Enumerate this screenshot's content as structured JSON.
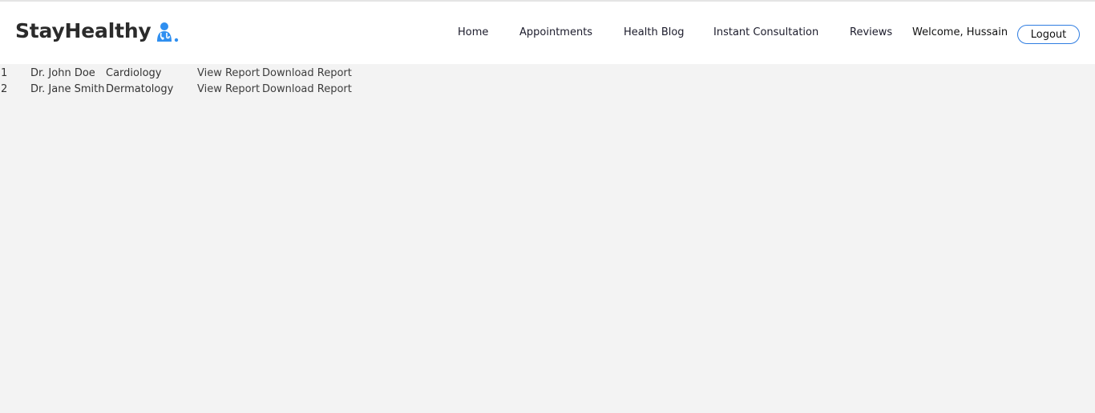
{
  "brand": {
    "name": "StayHealthy",
    "icon": "doctor-icon",
    "icon_color": "#2f8ff0"
  },
  "nav": {
    "items": [
      {
        "label": "Home"
      },
      {
        "label": "Appointments"
      },
      {
        "label": "Health Blog"
      },
      {
        "label": "Instant Consultation"
      },
      {
        "label": "Reviews"
      }
    ],
    "welcome": "Welcome, Hussain",
    "logout_label": "Logout",
    "accent": "#2f7de1"
  },
  "reports": {
    "rows": [
      {
        "num": "1",
        "doctor": "Dr. John Doe",
        "specialty": "Cardiology",
        "view": "View Report",
        "download": "Download Report"
      },
      {
        "num": "2",
        "doctor": "Dr. Jane Smith",
        "specialty": "Dermatology",
        "view": "View Report",
        "download": "Download Report"
      }
    ]
  }
}
